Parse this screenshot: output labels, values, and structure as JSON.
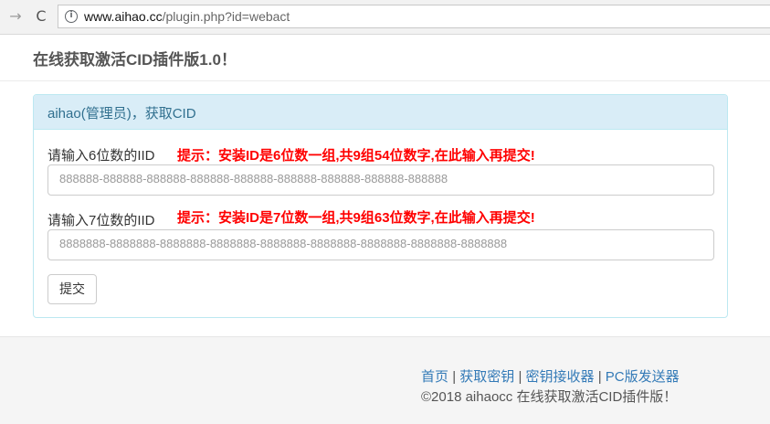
{
  "browser": {
    "url_host": "www.aihao.cc",
    "url_path": "/plugin.php?id=webact",
    "back_glyph": "→",
    "reload_glyph": "C",
    "info_glyph": "i"
  },
  "header": {
    "title": "在线获取激活CID插件版1.0！"
  },
  "panel": {
    "heading": "aihao(管理员)，获取CID",
    "field1": {
      "label": "请输入6位数的IID",
      "hint": "提示：安装ID是6位数一组,共9组54位数字,在此输入再提交!",
      "placeholder": "888888-888888-888888-888888-888888-888888-888888-888888-888888"
    },
    "field2": {
      "label": "请输入7位数的IID",
      "hint": "提示：安装ID是7位数一组,共9组63位数字,在此输入再提交!",
      "placeholder": "8888888-8888888-8888888-8888888-8888888-8888888-8888888-8888888-8888888"
    },
    "submit_label": "提交"
  },
  "footer": {
    "links": [
      "首页",
      "获取密钥",
      "密钥接收器",
      "PC版发送器"
    ],
    "separator": "|",
    "copyright": "©2018 aihaocc 在线获取激活CID插件版！"
  },
  "colors": {
    "panel_heading_bg": "#d9edf7",
    "panel_heading_text": "#31708f",
    "hint_text": "#ff0000",
    "link": "#337ab7"
  }
}
